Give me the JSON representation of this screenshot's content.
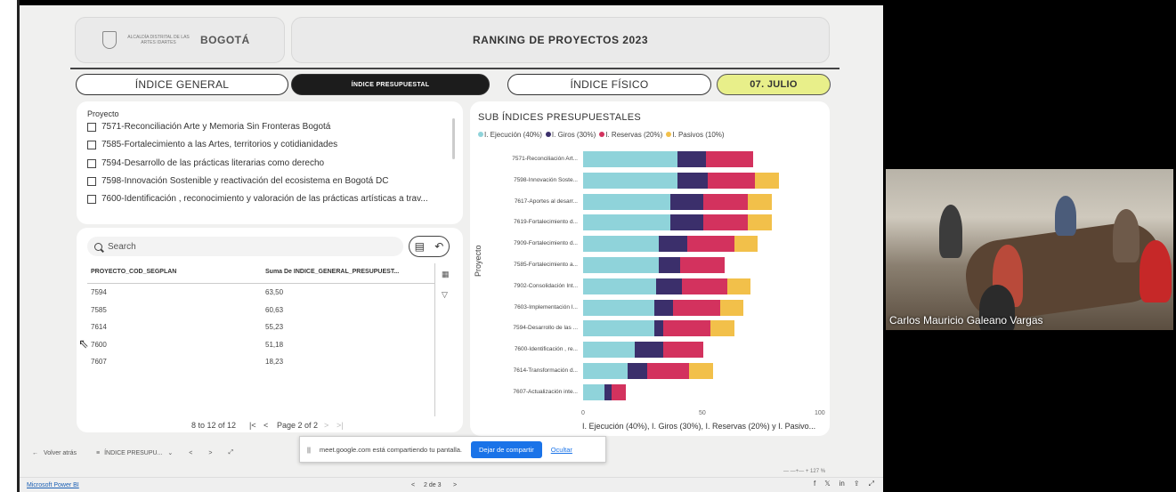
{
  "header": {
    "logo_text": "ALCALDÍA DISTRITAL DE LAS ARTES IDARTES",
    "logo_brand": "BOGOTÁ",
    "title": "RANKING DE PROYECTOS 2023"
  },
  "tabs": {
    "general": "ÍNDICE GENERAL",
    "presupuestal": "ÍNDICE PRESUPUESTAL",
    "fisico": "ÍNDICE FÍSICO",
    "date": "07. JULIO"
  },
  "slicer": {
    "title": "Proyecto",
    "items": [
      "7571-Reconciliación Arte y Memoria Sin Fronteras Bogotá",
      "7585-Fortalecimiento a las Artes, territorios y cotidianidades",
      "7594-Desarrollo de las prácticas literarias como derecho",
      "7598-Innovación Sostenible y reactivación del ecosistema en Bogotá DC",
      "7600-Identificación , reconocimiento y valoración de las prácticas artísticas a trav..."
    ]
  },
  "table": {
    "search_placeholder": "Search",
    "columns": [
      "PROYECTO_COD_SEGPLAN",
      "Suma De INDICE_GENERAL_PRESUPUEST..."
    ],
    "rows": [
      {
        "code": "7594",
        "value": "63,50"
      },
      {
        "code": "7585",
        "value": "60,63"
      },
      {
        "code": "7614",
        "value": "55,23"
      },
      {
        "code": "7600",
        "value": "51,18"
      },
      {
        "code": "7607",
        "value": "18,23"
      }
    ],
    "pager_count": "8 to 12 of 12",
    "pager_page": "Page 2 of 2"
  },
  "chart_data": {
    "type": "bar",
    "title": "SUB ÍNDICES PRESUPUESTALES",
    "orientation": "horizontal",
    "stacked": true,
    "ylabel": "Proyecto",
    "xlabel": "I. Ejecución (40%), I. Giros (30%), I. Reservas (20%) y I. Pasivo...",
    "xlim": [
      0,
      100
    ],
    "xticks": [
      "0",
      "50",
      "100"
    ],
    "categories": [
      "7571-Reconciliación Art...",
      "7598-Innovación Soste...",
      "7617-Aportes al desarr...",
      "7619-Fortalecimiento d...",
      "7909-Fortalecimiento d...",
      "7585-Fortalecimiento a...",
      "7902-Consolidación Int...",
      "7603-Implementación I...",
      "7594-Desarrollo de las ...",
      "7600-Identificación , re...",
      "7614-Transformación d...",
      "7607-Actualización inte..."
    ],
    "series": [
      {
        "name": "I. Ejecución (40%)",
        "color": "#8fd3da",
        "values": [
          40,
          40,
          37,
          37,
          32,
          32,
          31,
          30,
          30,
          22,
          19,
          9
        ]
      },
      {
        "name": "I. Giros (30%)",
        "color": "#3b2f6b",
        "values": [
          12,
          13,
          14,
          14,
          12,
          9,
          11,
          8,
          4,
          12,
          8,
          3
        ]
      },
      {
        "name": "I. Reservas (20%)",
        "color": "#d3325e",
        "values": [
          20,
          20,
          19,
          19,
          20,
          19,
          19,
          20,
          20,
          17,
          18,
          6
        ]
      },
      {
        "name": "I. Pasivos (10%)",
        "color": "#f2c04a",
        "values": [
          0,
          10,
          10,
          10,
          10,
          0,
          10,
          10,
          10,
          0,
          10,
          0
        ]
      }
    ]
  },
  "nav": {
    "back": "Volver atrás",
    "page_tab": "ÍNDICE PRESUPU...",
    "page_indicator": "2 de 3"
  },
  "share": {
    "message": "meet.google.com está compartiendo tu pantalla.",
    "stop_button": "Dejar de compartir",
    "hide_link": "Ocultar"
  },
  "status": {
    "app_name": "Microsoft Power BI",
    "zoom": "127 %"
  },
  "video": {
    "participant_name": "Carlos Mauricio Galeano Vargas"
  }
}
